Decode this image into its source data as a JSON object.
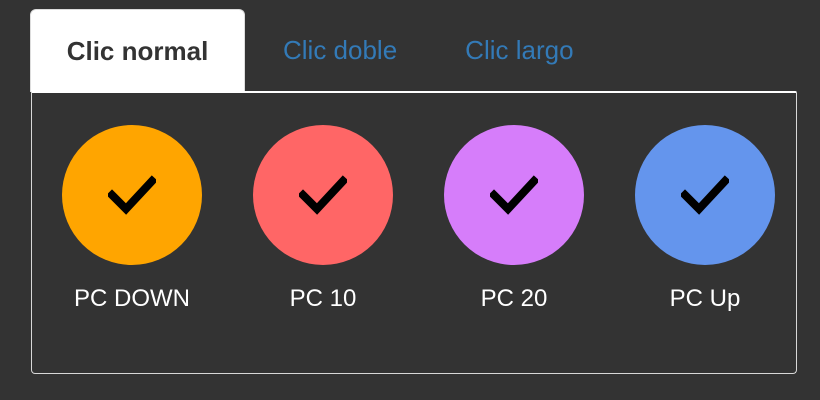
{
  "tabs": [
    {
      "label": "Clic normal",
      "active": true
    },
    {
      "label": "Clic doble",
      "active": false
    },
    {
      "label": "Clic largo",
      "active": false
    }
  ],
  "options": [
    {
      "label": "PC DOWN",
      "color": "#ffa500",
      "icon": "check-icon",
      "selected": true
    },
    {
      "label": "PC 10",
      "color": "#ff6666",
      "icon": "check-icon",
      "selected": true
    },
    {
      "label": "PC 20",
      "color": "#d67dfa",
      "icon": "check-icon",
      "selected": true
    },
    {
      "label": "PC Up",
      "color": "#6495ed",
      "icon": "check-icon",
      "selected": true
    }
  ]
}
